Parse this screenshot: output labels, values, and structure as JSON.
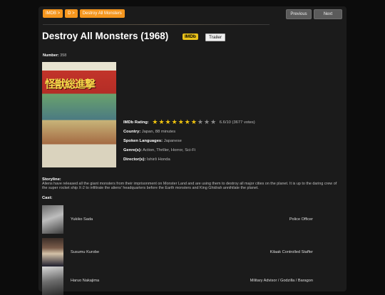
{
  "breadcrumbs": [
    "IMDB >",
    "D >",
    "Destroy All Monsters"
  ],
  "nav": {
    "previous": "Previous",
    "next": "Next"
  },
  "movie": {
    "title": "Destroy All Monsters (1968)",
    "imdb_badge": "IMDb",
    "trailer_label": "Trailer",
    "number_label": "Number:",
    "number_value": "358",
    "poster_title": "怪獣総進撃"
  },
  "info": {
    "rating_label": "IMDb Rating:",
    "rating_text": "6.6/10 (3677 votes)",
    "rating_stars": 6.6,
    "rating_max": 10,
    "country_label": "Country:",
    "country_value": "Japan, 88 minutes",
    "languages_label": "Spoken Languages:",
    "languages_value": "Japanese",
    "genres_label": "Genre(s):",
    "genres_value": "Action, Thriller, Horror, Sci-Fi",
    "directors_label": "Director(s):",
    "directors_value": "Ishirô Honda"
  },
  "storyline": {
    "label": "Storyline:",
    "text": "Aliens have released all the giant monsters from their imprisonment on Monster Land and are using them to destroy all major cities on the planet. It is up to the daring crew of the super rocket ship X-2 to infiltrate the aliens' headquarters before the Earth monsters and King Ghidrah annihilate the planet."
  },
  "cast_label": "Cast:",
  "cast": [
    {
      "name": "Yukiko Sada",
      "role": "Police Officer"
    },
    {
      "name": "Susumu Kurobe",
      "role": "Kilaak Controlled Staffer"
    },
    {
      "name": "Haruo Nakajima",
      "role": "Military Advisor / Godzilla / Baragon"
    }
  ],
  "colors": {
    "accent": "#f5961e",
    "star": "#f1c40f",
    "panel": "#1b1b1b"
  }
}
